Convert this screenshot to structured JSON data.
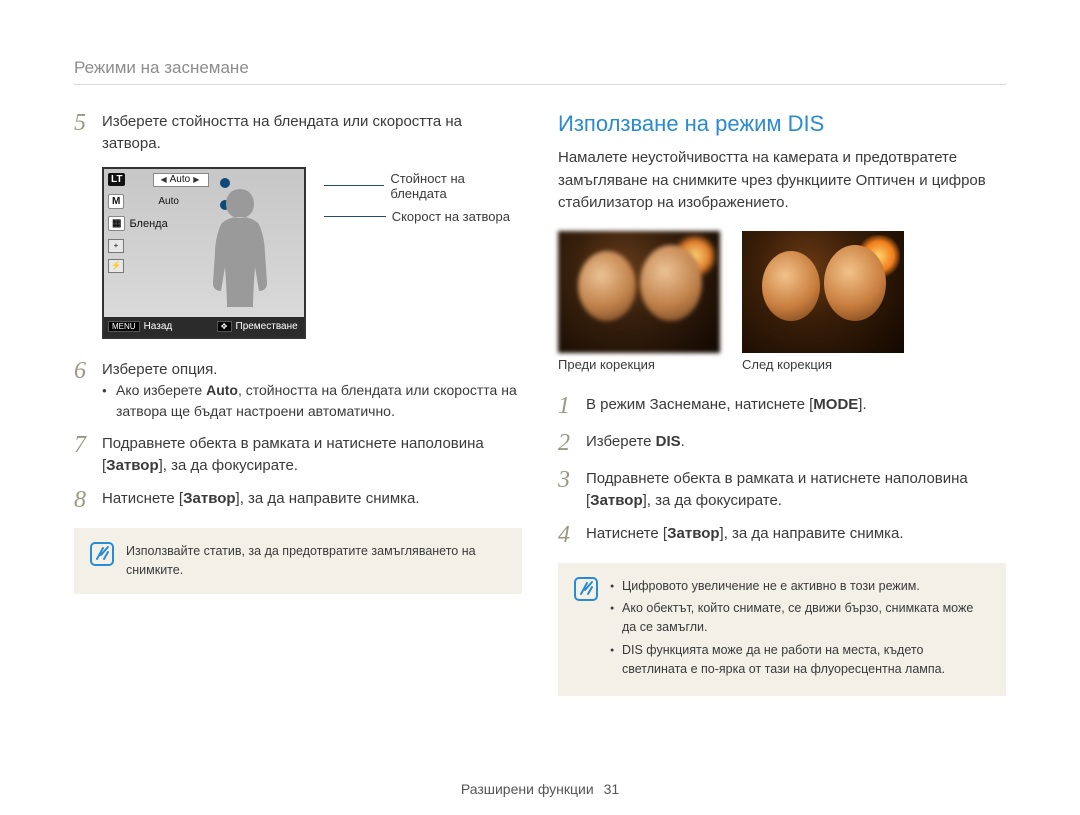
{
  "header": {
    "breadcrumb": "Режими на заснемане"
  },
  "left": {
    "step5": {
      "num": "5",
      "text_a": "Изберете стойността на блендата или скоростта на затвора."
    },
    "lcd": {
      "tag_lt": "LT",
      "tag_m": "M",
      "auto1": "Auto",
      "auto2": "Auto",
      "aperture_label": "Бленда",
      "back_btn": "MENU",
      "back_text": "Назад",
      "move_text": "Преместване"
    },
    "lcd_annot": {
      "aperture": "Стойност на блендата",
      "shutter": "Скорост на затвора"
    },
    "step6": {
      "num": "6",
      "text": "Изберете опция.",
      "bullet_pre": "Ако изберете ",
      "bullet_bold": "Auto",
      "bullet_post": ", стойността на блендата или скоростта на затвора ще бъдат настроени автоматично."
    },
    "step7": {
      "num": "7",
      "text_a": "Подравнете обекта в рамката и натиснете наполовина [",
      "text_bold": "Затвор",
      "text_b": "], за да фокусирате."
    },
    "step8": {
      "num": "8",
      "text_a": "Натиснете [",
      "text_bold": "Затвор",
      "text_b": "], за да направите снимка."
    },
    "note": "Използвайте статив, за да предотвратите замъгляването на снимките."
  },
  "right": {
    "title": "Използване на режим DIS",
    "intro": "Намалете неустойчивостта на камерата и предотвратете замъгляване на снимките чрез функциите Оптичен и цифров стабилизатор на изображението.",
    "before": "Преди корекция",
    "after": "След корекция",
    "step1": {
      "num": "1",
      "text_a": "В режим Заснемане, натиснете [",
      "text_bold": "MODE",
      "text_b": "]."
    },
    "step2": {
      "num": "2",
      "text_a": "Изберете ",
      "text_bold": "DIS",
      "text_b": "."
    },
    "step3": {
      "num": "3",
      "text_a": "Подравнете обекта в рамката и натиснете наполовина [",
      "text_bold": "Затвор",
      "text_b": "], за да фокусирате."
    },
    "step4": {
      "num": "4",
      "text_a": "Натиснете [",
      "text_bold": "Затвор",
      "text_b": "], за да направите снимка."
    },
    "notes": {
      "n1": "Цифровото увеличение не е активно в този режим.",
      "n2": "Ако обектът, който снимате, се движи бързо, снимката може да се замъгли.",
      "n3": "DIS функцията може да не работи на места, където светлината е по-ярка от тази на флуоресцентна лампа."
    }
  },
  "footer": {
    "section": "Разширени функции",
    "page": "31"
  }
}
